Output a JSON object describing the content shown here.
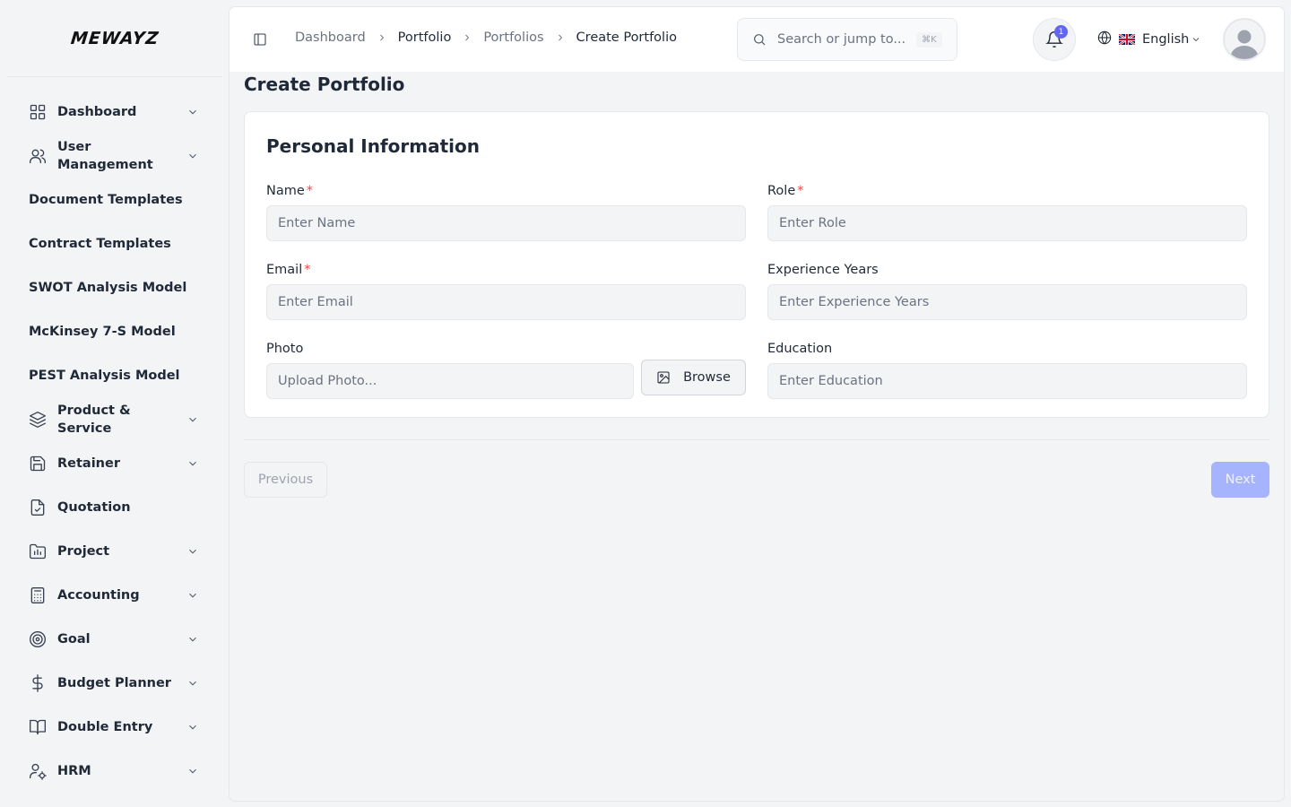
{
  "app": {
    "logo": "MEWAYZ"
  },
  "sidebar": {
    "items": [
      {
        "label": "Dashboard",
        "icon": "grid-icon",
        "has_chevron": true
      },
      {
        "label": "User Management",
        "icon": "users-icon",
        "has_chevron": true
      },
      {
        "label": "Document Templates",
        "icon": "",
        "has_chevron": false
      },
      {
        "label": "Contract Templates",
        "icon": "",
        "has_chevron": false
      },
      {
        "label": "SWOT Analysis Model",
        "icon": "",
        "has_chevron": false
      },
      {
        "label": "McKinsey 7-S Model",
        "icon": "",
        "has_chevron": false
      },
      {
        "label": "PEST Analysis Model",
        "icon": "",
        "has_chevron": false
      },
      {
        "label": "Product & Service",
        "icon": "layers-icon",
        "has_chevron": true
      },
      {
        "label": "Retainer",
        "icon": "save-icon",
        "has_chevron": true
      },
      {
        "label": "Quotation",
        "icon": "file-check-icon",
        "has_chevron": false
      },
      {
        "label": "Project",
        "icon": "folder-chart-icon",
        "has_chevron": true
      },
      {
        "label": "Accounting",
        "icon": "calculator-icon",
        "has_chevron": true
      },
      {
        "label": "Goal",
        "icon": "target-icon",
        "has_chevron": true
      },
      {
        "label": "Budget Planner",
        "icon": "dollar-icon",
        "has_chevron": true
      },
      {
        "label": "Double Entry",
        "icon": "book-icon",
        "has_chevron": true
      },
      {
        "label": "HRM",
        "icon": "user-cog-icon",
        "has_chevron": true
      }
    ]
  },
  "header": {
    "breadcrumb": [
      "Dashboard",
      "Portfolio",
      "Portfolios",
      "Create Portfolio"
    ],
    "search_placeholder": "Search or jump to...",
    "search_shortcut": "⌘K",
    "notification_count": "1",
    "language": "English",
    "language_flag": "🇬🇧"
  },
  "page": {
    "title": "Create Portfolio",
    "section_title": "Personal Information",
    "fields": {
      "name": {
        "label": "Name",
        "required": "*",
        "placeholder": "Enter Name"
      },
      "role": {
        "label": "Role",
        "required": "*",
        "placeholder": "Enter Role"
      },
      "email": {
        "label": "Email",
        "required": "*",
        "placeholder": "Enter Email"
      },
      "experience": {
        "label": "Experience Years",
        "placeholder": "Enter Experience Years"
      },
      "photo": {
        "label": "Photo",
        "placeholder": "Upload Photo...",
        "browse_label": "Browse"
      },
      "education": {
        "label": "Education",
        "placeholder": "Enter Education"
      }
    },
    "previous_label": "Previous",
    "next_label": "Next"
  },
  "colors": {
    "accent": "#6366f1",
    "next_button": "#a5b4fc",
    "required": "#ef4444"
  }
}
